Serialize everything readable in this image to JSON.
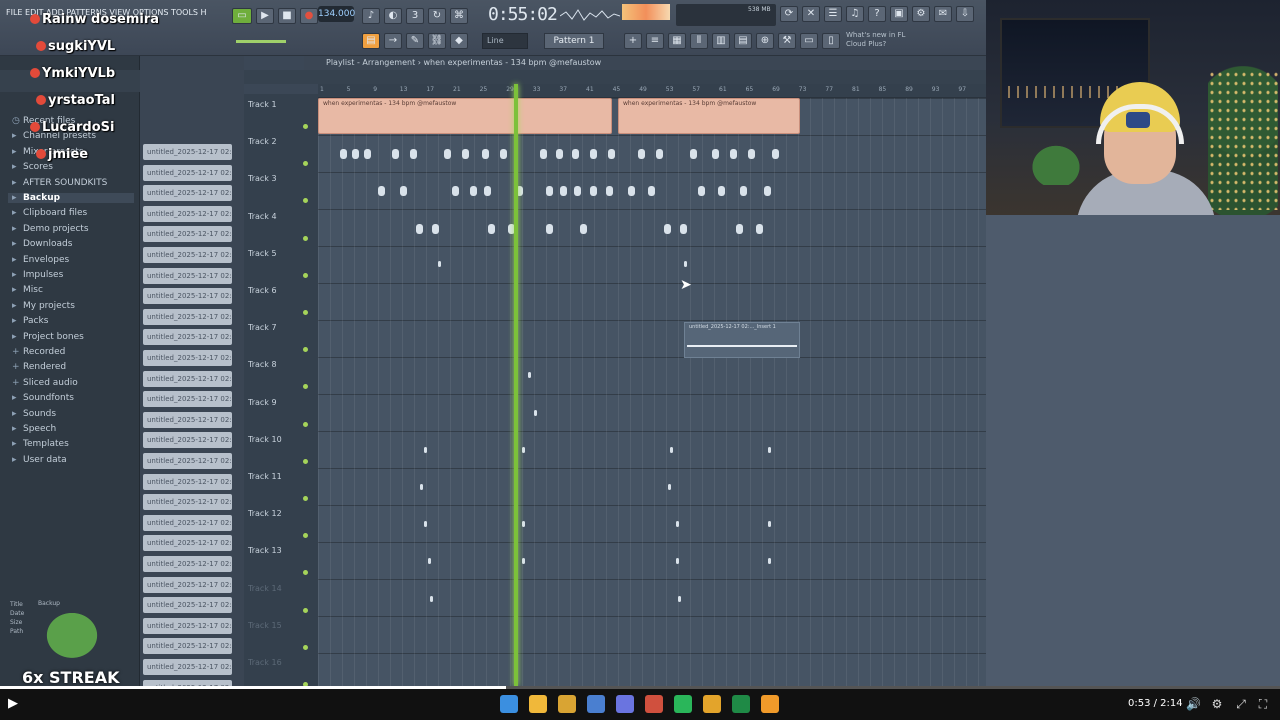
{
  "toolbar": {
    "menu_text": "FILE EDIT ADD PATTERNS VIEW OPTIONS TOOLS HELP",
    "tempo": "134.000",
    "time": "0:55:02",
    "memory": "538 MB",
    "line_mode": "Line",
    "pattern": "Pattern 1",
    "hint": "What's new in FL Cloud Plus?",
    "accent": "#7cc13a"
  },
  "playlist": {
    "title": "Playlist - Arrangement › when experimentas - 134 bpm @mefaustow",
    "ticks": [
      "1",
      "5",
      "9",
      "13",
      "17",
      "21",
      "25",
      "29",
      "33",
      "37",
      "41",
      "45",
      "49",
      "53",
      "57",
      "61",
      "65",
      "69",
      "73",
      "77",
      "81",
      "85",
      "89",
      "93",
      "97"
    ],
    "tracks": [
      "Track 1",
      "Track 2",
      "Track 3",
      "Track 4",
      "Track 5",
      "Track 6",
      "Track 7",
      "Track 8",
      "Track 9",
      "Track 10",
      "Track 11",
      "Track 12",
      "Track 13",
      "Track 14",
      "Track 15",
      "Track 16"
    ],
    "clip_label_1": "when experimentas - 134 bpm @mefaustow",
    "clip_label_2": "when experimentas - 134 bpm @mefaustow",
    "clip_label_7": "untitled_2025-12-17 02:..._Insert 1",
    "playhead_color": "#7cc13a"
  },
  "browser": {
    "items": [
      {
        "label": "Recent files",
        "icon": "clock-icon"
      },
      {
        "label": "Channel presets",
        "icon": "folder-icon"
      },
      {
        "label": "Mixer presets",
        "icon": "folder-icon"
      },
      {
        "label": "Scores",
        "icon": "folder-icon"
      },
      {
        "label": "AFTER SOUNDKITS",
        "icon": "folder-icon"
      },
      {
        "label": "Backup",
        "icon": "folder-icon"
      },
      {
        "label": "Clipboard files",
        "icon": "folder-icon"
      },
      {
        "label": "Demo projects",
        "icon": "folder-icon"
      },
      {
        "label": "Downloads",
        "icon": "folder-icon"
      },
      {
        "label": "Envelopes",
        "icon": "folder-icon"
      },
      {
        "label": "Impulses",
        "icon": "folder-icon"
      },
      {
        "label": "Misc",
        "icon": "folder-icon"
      },
      {
        "label": "My projects",
        "icon": "folder-icon"
      },
      {
        "label": "Packs",
        "icon": "folder-icon"
      },
      {
        "label": "Project bones",
        "icon": "folder-icon"
      },
      {
        "label": "Recorded",
        "icon": "plus-icon"
      },
      {
        "label": "Rendered",
        "icon": "plus-icon"
      },
      {
        "label": "Sliced audio",
        "icon": "plus-icon"
      },
      {
        "label": "Soundfonts",
        "icon": "folder-icon"
      },
      {
        "label": "Sounds",
        "icon": "folder-icon"
      },
      {
        "label": "Speech",
        "icon": "folder-icon"
      },
      {
        "label": "Templates",
        "icon": "folder-icon"
      },
      {
        "label": "User data",
        "icon": "folder-icon"
      }
    ],
    "info_title": "Title",
    "info_title_value": "Backup",
    "info_date": "Date",
    "info_size": "Size",
    "info_path": "Path"
  },
  "midlist": {
    "items": [
      "untitled_2025-12-17 02:",
      "untitled_2025-12-17 02:",
      "untitled_2025-12-17 02:",
      "untitled_2025-12-17 02:",
      "untitled_2025-12-17 02:",
      "untitled_2025-12-17 02:",
      "untitled_2025-12-17 02:",
      "untitled_2025-12-17 02:",
      "untitled_2025-12-17 02:",
      "untitled_2025-12-17 02:",
      "untitled_2025-12-17 02:",
      "untitled_2025-12-17 02:",
      "untitled_2025-12-17 02:",
      "untitled_2025-12-17 02:",
      "untitled_2025-12-17 02:",
      "untitled_2025-12-17 02:",
      "untitled_2025-12-17 02:",
      "untitled_2025-12-17 02:",
      "untitled_2025-12-17 02:",
      "untitled_2025-12-17 02:",
      "untitled_2025-12-17 02:",
      "untitled_2025-12-17 02:",
      "untitled_2025-12-17 02:",
      "untitled_2025-12-17 02:",
      "untitled_2025-12-17 02:",
      "untitled_2025-12-17 02:",
      "untitled_2025-12-17 02:"
    ]
  },
  "chat": {
    "lines": [
      "Rainw dosemira",
      "sugkiYVL",
      "YmkiYVLb",
      "yrstaoTal",
      "LucardoSi",
      "jmiee"
    ],
    "streak": "6x STREAK"
  },
  "video": {
    "time": "0:53 / 2:14",
    "progress": 0.395
  }
}
